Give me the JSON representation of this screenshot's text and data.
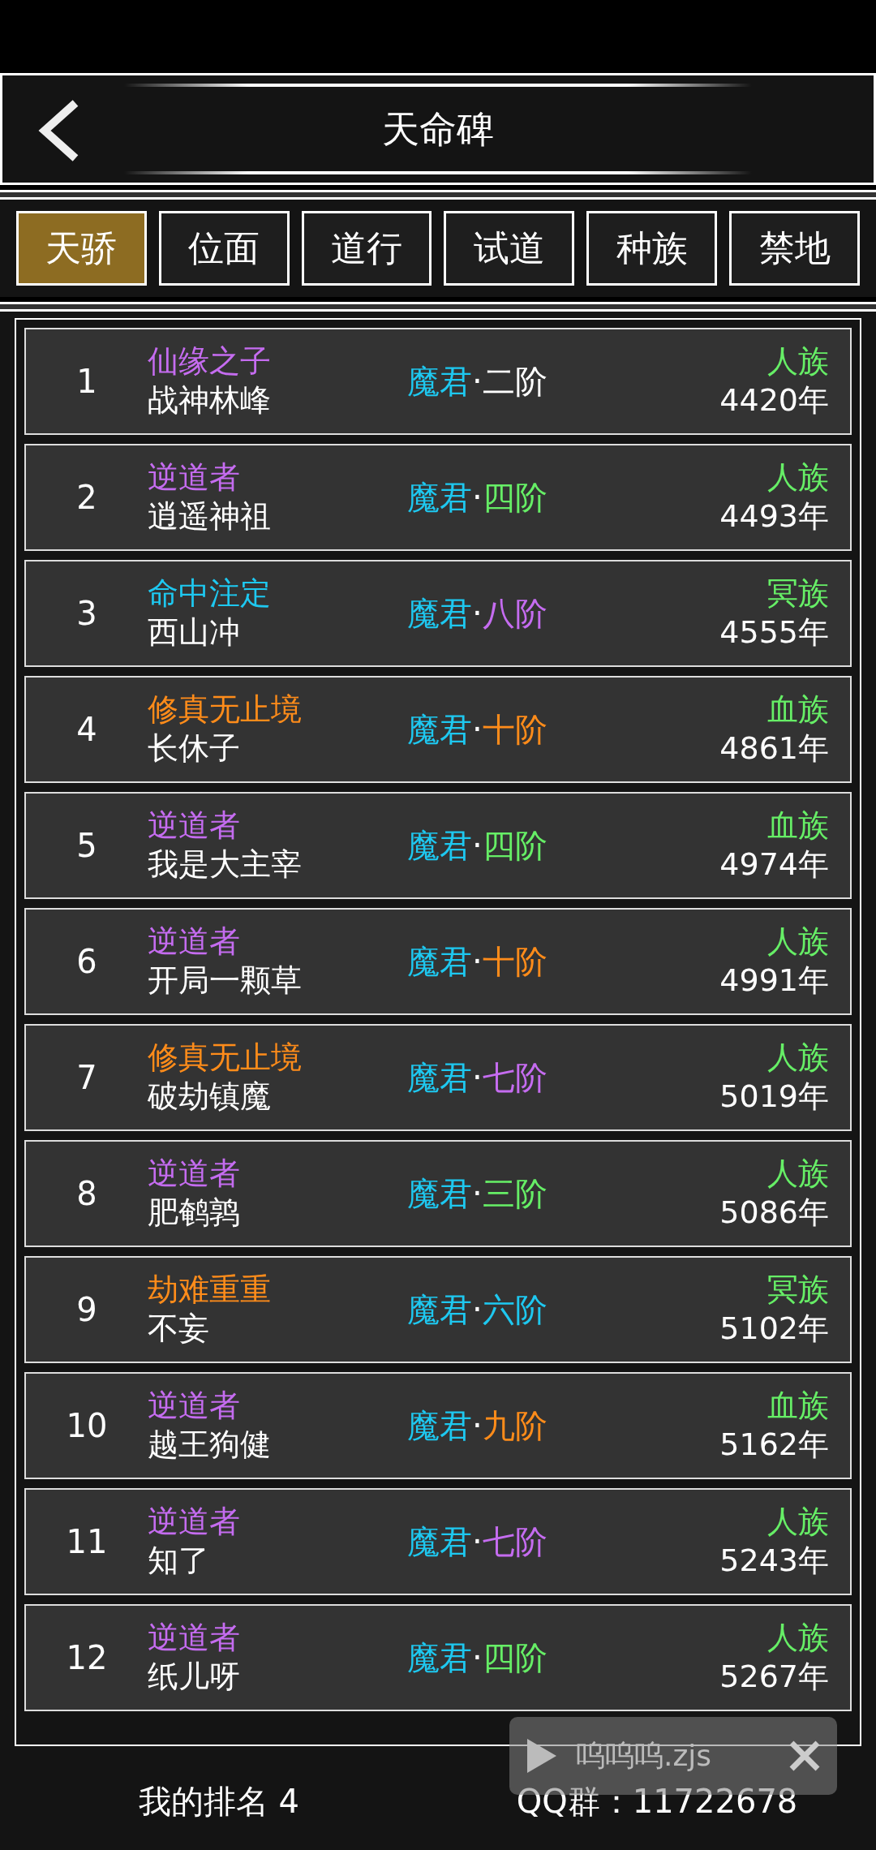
{
  "header": {
    "title": "天命碑"
  },
  "tabs": [
    {
      "label": "天骄",
      "selected": true
    },
    {
      "label": "位面",
      "selected": false
    },
    {
      "label": "道行",
      "selected": false
    },
    {
      "label": "试道",
      "selected": false
    },
    {
      "label": "种族",
      "selected": false
    },
    {
      "label": "禁地",
      "selected": false
    }
  ],
  "rows": [
    {
      "rank": "1",
      "title": {
        "text": "仙缘之子",
        "color": "#c56cf0"
      },
      "name": "战神林峰",
      "realm": "魔君",
      "stage": {
        "text": "二阶",
        "color": "#ffffff"
      },
      "race": {
        "text": "人族",
        "color": "#66ee66"
      },
      "age": "4420年"
    },
    {
      "rank": "2",
      "title": {
        "text": "逆道者",
        "color": "#c56cf0"
      },
      "name": "逍遥神祖",
      "realm": "魔君",
      "stage": {
        "text": "四阶",
        "color": "#66ee66"
      },
      "race": {
        "text": "人族",
        "color": "#66ee66"
      },
      "age": "4493年"
    },
    {
      "rank": "3",
      "title": {
        "text": "命中注定",
        "color": "#1ec8f0"
      },
      "name": "西山冲",
      "realm": "魔君",
      "stage": {
        "text": "八阶",
        "color": "#c56cf0"
      },
      "race": {
        "text": "冥族",
        "color": "#66ee66"
      },
      "age": "4555年"
    },
    {
      "rank": "4",
      "title": {
        "text": "修真无止境",
        "color": "#ff8c1a"
      },
      "name": "长休子",
      "realm": "魔君",
      "stage": {
        "text": "十阶",
        "color": "#ff8c1a"
      },
      "race": {
        "text": "血族",
        "color": "#66ee66"
      },
      "age": "4861年"
    },
    {
      "rank": "5",
      "title": {
        "text": "逆道者",
        "color": "#c56cf0"
      },
      "name": "我是大主宰",
      "realm": "魔君",
      "stage": {
        "text": "四阶",
        "color": "#66ee66"
      },
      "race": {
        "text": "血族",
        "color": "#66ee66"
      },
      "age": "4974年"
    },
    {
      "rank": "6",
      "title": {
        "text": "逆道者",
        "color": "#c56cf0"
      },
      "name": "开局一颗草",
      "realm": "魔君",
      "stage": {
        "text": "十阶",
        "color": "#ff8c1a"
      },
      "race": {
        "text": "人族",
        "color": "#66ee66"
      },
      "age": "4991年"
    },
    {
      "rank": "7",
      "title": {
        "text": "修真无止境",
        "color": "#ff8c1a"
      },
      "name": "破劫镇魔",
      "realm": "魔君",
      "stage": {
        "text": "七阶",
        "color": "#c56cf0"
      },
      "race": {
        "text": "人族",
        "color": "#66ee66"
      },
      "age": "5019年"
    },
    {
      "rank": "8",
      "title": {
        "text": "逆道者",
        "color": "#c56cf0"
      },
      "name": "肥鹌鹑",
      "realm": "魔君",
      "stage": {
        "text": "三阶",
        "color": "#66ee66"
      },
      "race": {
        "text": "人族",
        "color": "#66ee66"
      },
      "age": "5086年"
    },
    {
      "rank": "9",
      "title": {
        "text": "劫难重重",
        "color": "#ff8c1a"
      },
      "name": "不妄",
      "realm": "魔君",
      "stage": {
        "text": "六阶",
        "color": "#1ec8f0"
      },
      "race": {
        "text": "冥族",
        "color": "#66ee66"
      },
      "age": "5102年"
    },
    {
      "rank": "10",
      "title": {
        "text": "逆道者",
        "color": "#c56cf0"
      },
      "name": "越王狗健",
      "realm": "魔君",
      "stage": {
        "text": "九阶",
        "color": "#ff8c1a"
      },
      "race": {
        "text": "血族",
        "color": "#66ee66"
      },
      "age": "5162年"
    },
    {
      "rank": "11",
      "title": {
        "text": "逆道者",
        "color": "#c56cf0"
      },
      "name": "知了",
      "realm": "魔君",
      "stage": {
        "text": "七阶",
        "color": "#c56cf0"
      },
      "race": {
        "text": "人族",
        "color": "#66ee66"
      },
      "age": "5243年"
    },
    {
      "rank": "12",
      "title": {
        "text": "逆道者",
        "color": "#c56cf0"
      },
      "name": "纸儿呀",
      "realm": "魔君",
      "stage": {
        "text": "四阶",
        "color": "#66ee66"
      },
      "race": {
        "text": "人族",
        "color": "#66ee66"
      },
      "age": "5267年"
    }
  ],
  "separator": "·",
  "footer": {
    "my_rank": "我的排名 4",
    "qq_group": "QQ群：11722678"
  },
  "floating_widget": {
    "label": "呜呜呜.zjs"
  }
}
